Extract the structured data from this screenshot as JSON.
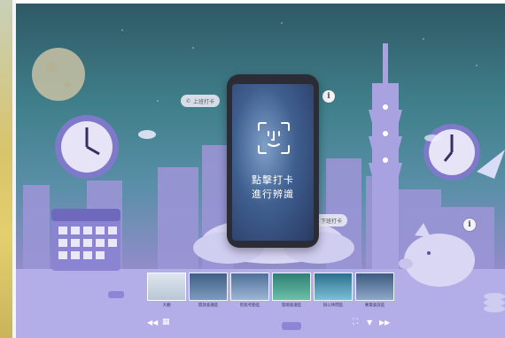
{
  "checkin_pill": {
    "label": "上班打卡"
  },
  "checkout_pill": {
    "label": "下班打卡"
  },
  "phone_screen": {
    "line1": "點擊打卡",
    "line2": "進行辨識"
  },
  "thumbnails": [
    {
      "caption": "大廳",
      "color": "#b9c6d6"
    },
    {
      "caption": "開放會議區",
      "color": "#5e7fa3"
    },
    {
      "caption": "智能考勤區",
      "color": "#6f93b8"
    },
    {
      "caption": "雲端會議區",
      "color": "#4ea38f"
    },
    {
      "caption": "辦公休閒區",
      "color": "#3f8fa6"
    },
    {
      "caption": "專業會談區",
      "color": "#5a7ba0"
    }
  ],
  "controls": {
    "prev": "◀◀",
    "grid": "▦",
    "fullscreen": "⛶",
    "down": "▼",
    "next": "▶▶"
  },
  "icons": {
    "info": "i",
    "phone_icon": "✆"
  },
  "colors": {
    "accent": "#8e86d6",
    "panel": "#ecebf5"
  }
}
